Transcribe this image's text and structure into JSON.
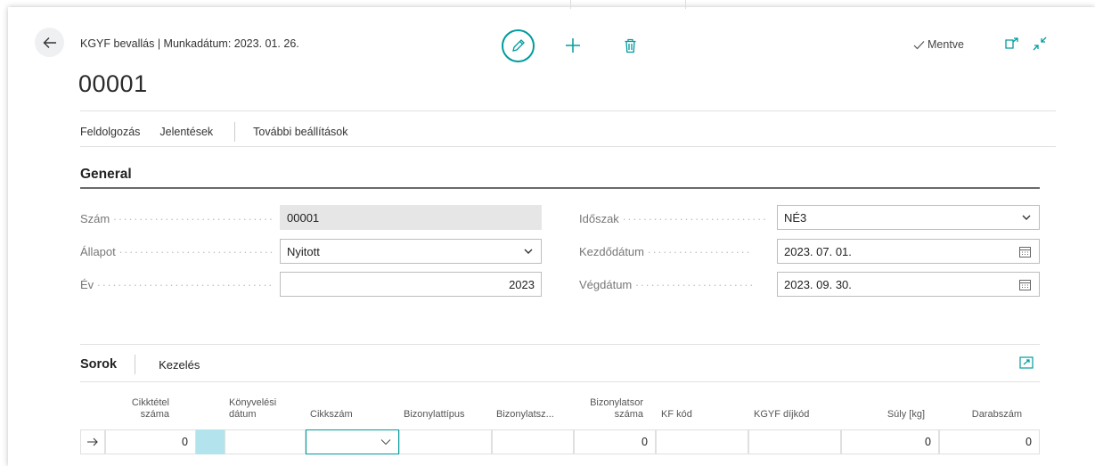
{
  "header": {
    "breadcrumb": "KGYF bevallás | Munkadátum: 2023. 01. 26.",
    "record_no": "00001",
    "saved_label": "Mentve"
  },
  "actions": {
    "items": [
      "Feldolgozás",
      "Jelentések",
      "További beállítások"
    ]
  },
  "general": {
    "title": "General",
    "fields": {
      "szam": {
        "label": "Szám",
        "value": "00001"
      },
      "allapot": {
        "label": "Állapot",
        "value": "Nyitott"
      },
      "ev": {
        "label": "Év",
        "value": "2023"
      },
      "idoszak": {
        "label": "Időszak",
        "value": "NÉ3"
      },
      "kezdodatum": {
        "label": "Kezdődátum",
        "value": "2023. 07. 01."
      },
      "vegdatum": {
        "label": "Végdátum",
        "value": "2023. 09. 30."
      }
    }
  },
  "lines": {
    "title": "Sorok",
    "manage": "Kezelés",
    "columns": {
      "cikktetel_1": "Cikktétel",
      "cikktetel_2": "száma",
      "konyvelesi_1": "Könyvelési",
      "konyvelesi_2": "dátum",
      "cikkszam": "Cikkszám",
      "bizonylattipus": "Bizonylattípus",
      "bizonylatsz": "Bizonylatsz...",
      "bizonylatsor_1": "Bizonylatsor",
      "bizonylatsor_2": "száma",
      "kf_kod": "KF kód",
      "kgyf_dijkod": "KGYF díjkód",
      "suly": "Súly [kg]",
      "darabszam": "Darabszám"
    },
    "row": {
      "cikktetel": "0",
      "bizonylatsor": "0",
      "suly": "0",
      "darabszam": "0"
    }
  },
  "colors": {
    "accent": "#009b9e",
    "selected_cell": "#b3e3ec"
  }
}
